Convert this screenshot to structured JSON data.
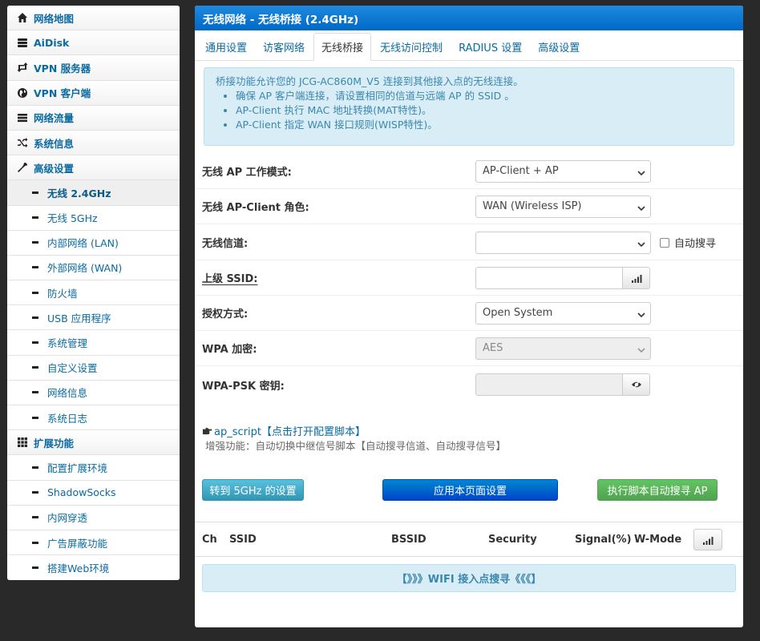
{
  "sidebar": {
    "items": [
      {
        "label": "网络地图",
        "icon": "home-icon"
      },
      {
        "label": "AiDisk",
        "icon": "hdd-icon"
      },
      {
        "label": "VPN 服务器",
        "icon": "retweet-icon"
      },
      {
        "label": "VPN 客户端",
        "icon": "globe-icon"
      },
      {
        "label": "网络流量",
        "icon": "tasks-icon"
      },
      {
        "label": "系统信息",
        "icon": "random-icon"
      },
      {
        "label": "高级设置",
        "icon": "wrench-icon"
      }
    ],
    "sub_items": [
      "无线 2.4GHz",
      "无线 5GHz",
      "内部网络 (LAN)",
      "外部网络 (WAN)",
      "防火墙",
      "USB 应用程序",
      "系统管理",
      "自定义设置",
      "网络信息",
      "系统日志"
    ],
    "ext_label": "扩展功能",
    "ext_items": [
      "配置扩展环境",
      "ShadowSocks",
      "内网穿透",
      "广告屏蔽功能",
      "搭建Web环境"
    ]
  },
  "panel": {
    "title": "无线网络 - 无线桥接 (2.4GHz)",
    "tabs": [
      "通用设置",
      "访客网络",
      "无线桥接",
      "无线访问控制",
      "RADIUS 设置",
      "高级设置"
    ],
    "info": {
      "intro": "桥接功能允许您的 JCG-AC860M_V5 连接到其他接入点的无线连接。",
      "bullets": [
        "确保 AP 客户端连接，请设置相同的信道与远端 AP 的 SSID 。",
        "AP-Client 执行 MAC 地址转换(MAT特性)。",
        "AP-Client 指定 WAN 接口规则(WISP特性)。"
      ]
    },
    "form": {
      "mode_label": "无线 AP 工作模式:",
      "mode_value": "AP-Client + AP",
      "role_label": "无线 AP-Client 角色:",
      "role_value": "WAN (Wireless ISP)",
      "channel_label": "无线信道:",
      "channel_value": "",
      "auto_scan_label": "自动搜寻",
      "ssid_label": "上级 SSID:",
      "auth_label": "授权方式:",
      "auth_value": "Open System",
      "wpa_label": "WPA 加密:",
      "wpa_value": "AES",
      "psk_label": "WPA-PSK 密钥:"
    },
    "script_link": "ap_script【点击打开配置脚本】",
    "script_desc": "增强功能：自动切换中继信号脚本【自动搜寻信道、自动搜寻信号】",
    "buttons": {
      "goto5g": "转到 5GHz 的设置",
      "apply": "应用本页面设置",
      "run_script": "执行脚本自动搜寻 AP"
    },
    "table": {
      "columns": [
        "Ch",
        "SSID",
        "BSSID",
        "Security",
        "Signal(%)",
        "W-Mode"
      ]
    },
    "scan_text": "【》》》WIFI 接入点搜寻《《《】"
  }
}
